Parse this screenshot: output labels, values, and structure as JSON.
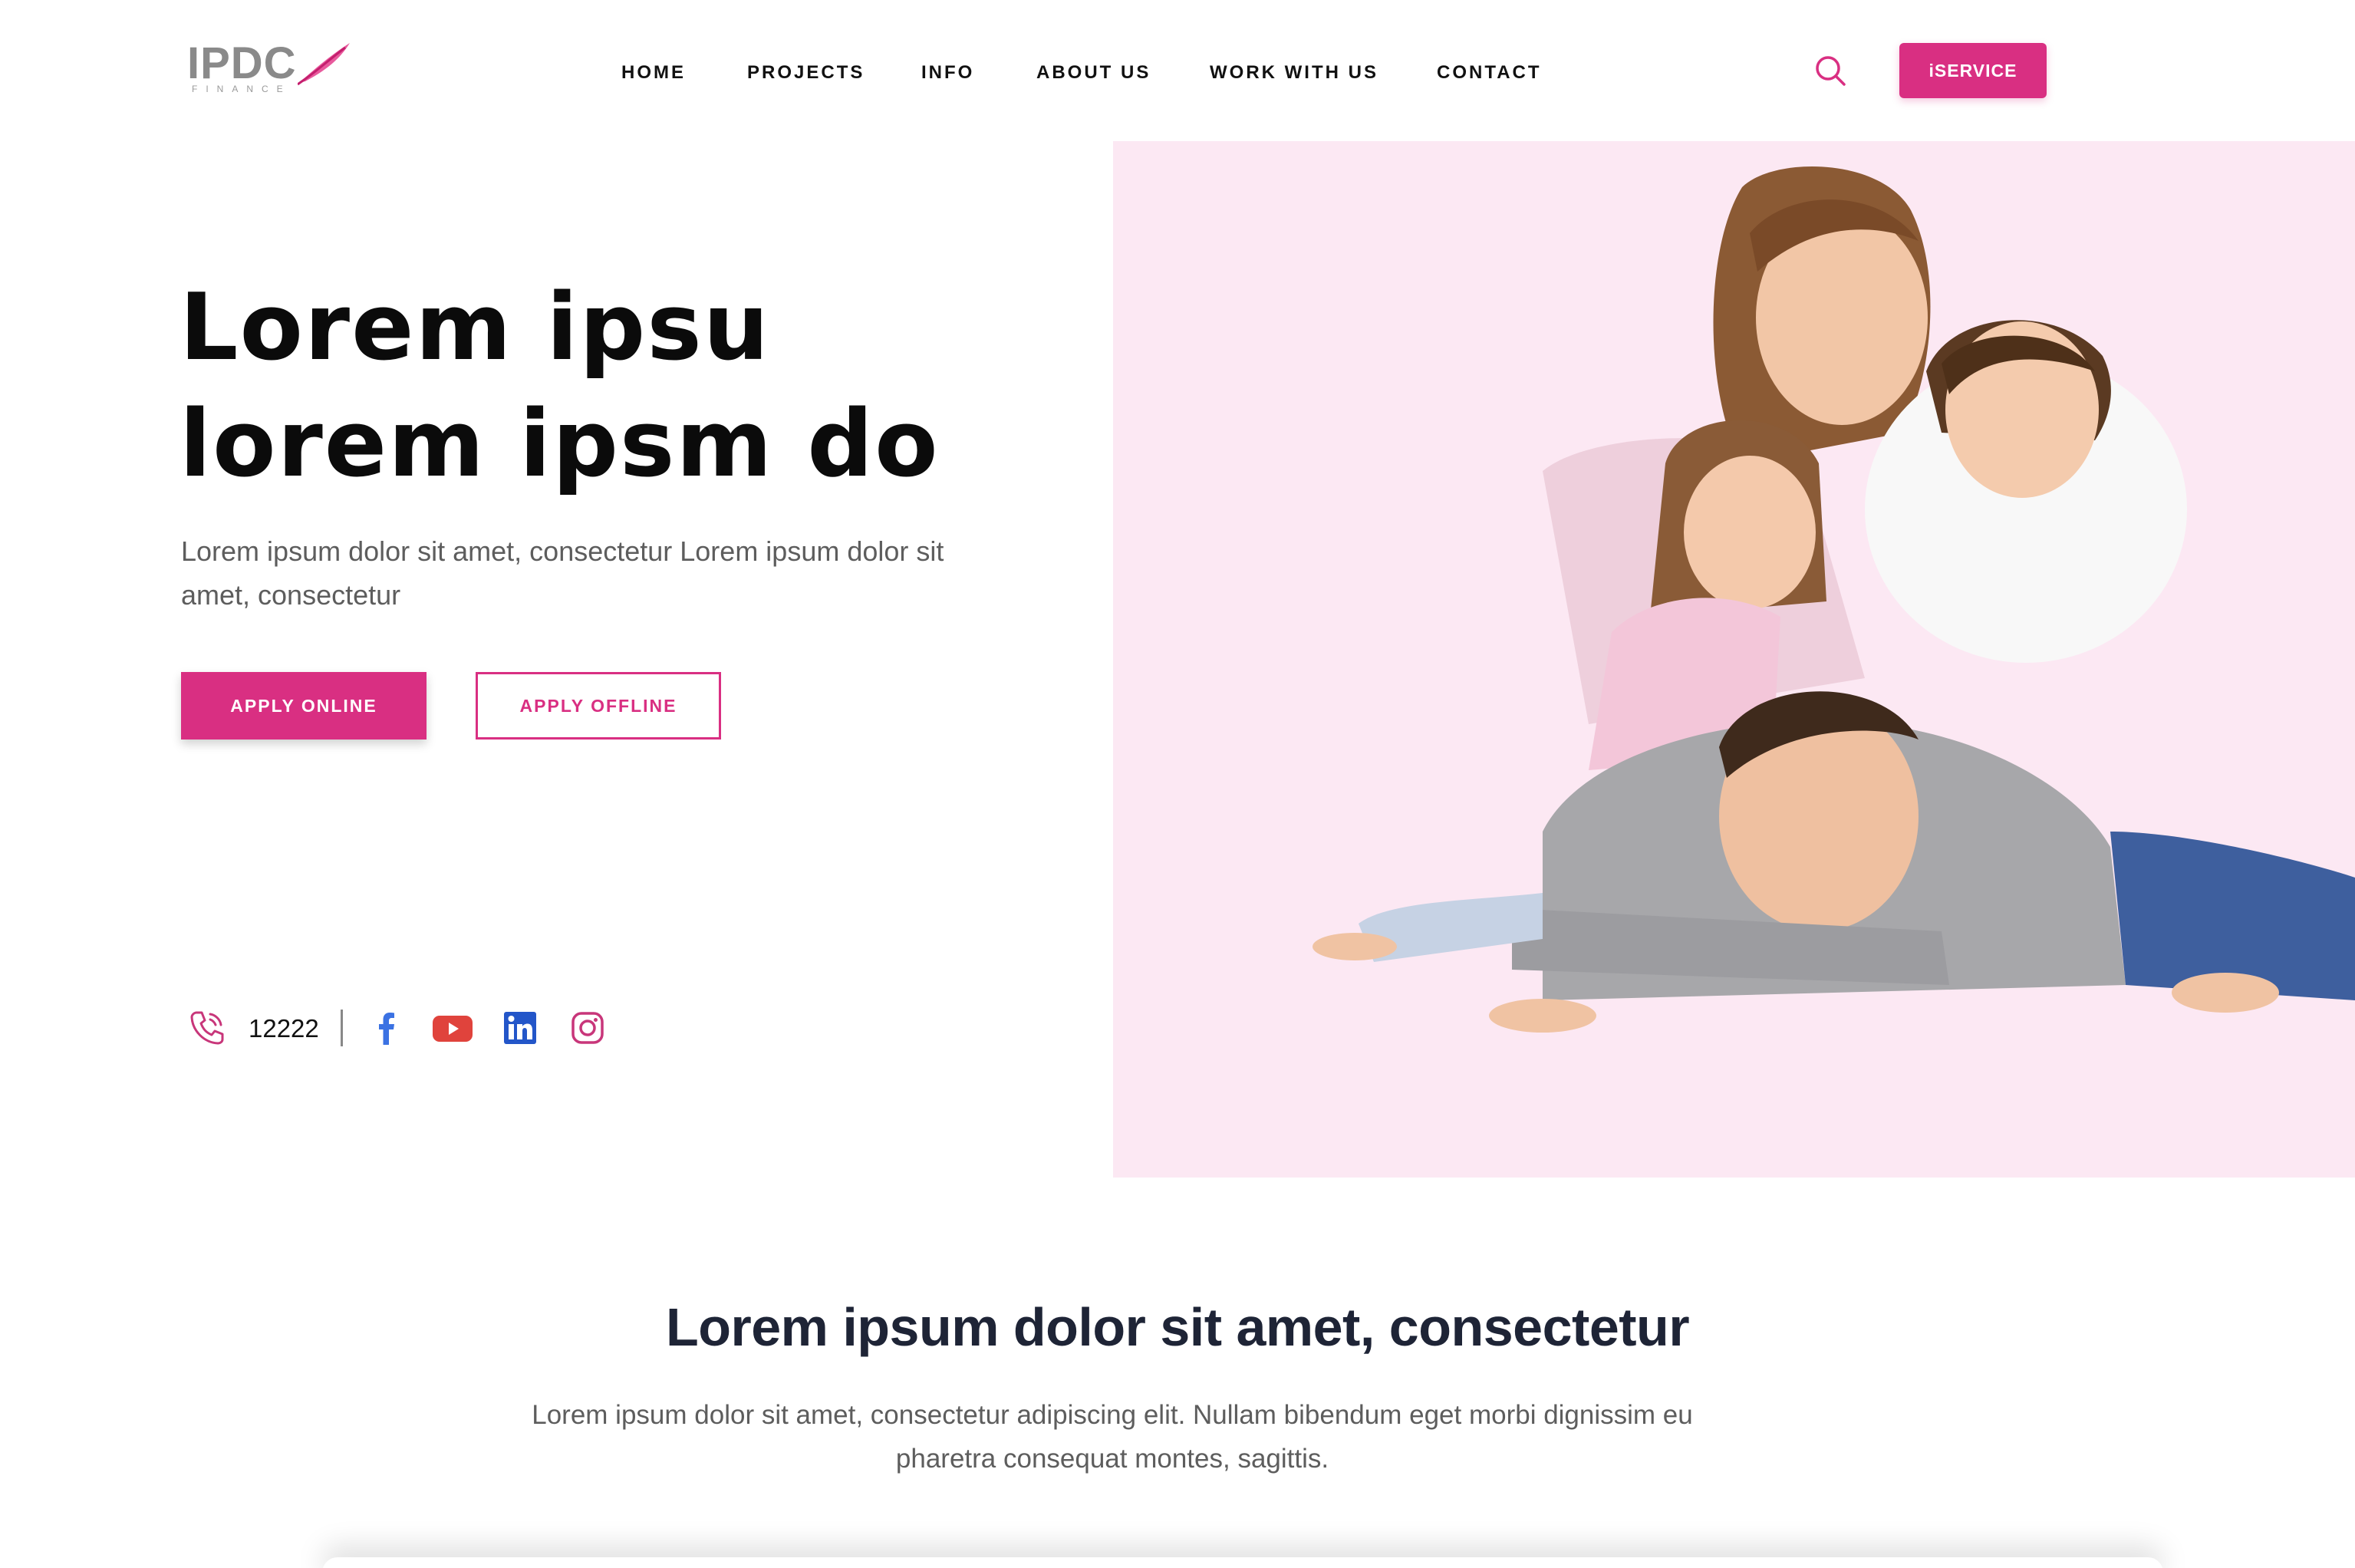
{
  "brand": {
    "logo_text": "IPDC",
    "logo_sub": "FINANCE"
  },
  "nav": {
    "items": [
      "HOME",
      "PROJECTS",
      "INFO",
      "ABOUT US",
      "WORK WITH US",
      "CONTACT"
    ],
    "cta_label": "iSERVICE"
  },
  "hero": {
    "title_line1": "Lorem ipsu",
    "title_line2": "lorem ipsm do",
    "description": "Lorem ipsum dolor sit amet, consectetur Lorem ipsum dolor sit amet, consectetur",
    "apply_online_label": "APPLY ONLINE",
    "apply_offline_label": "APPLY OFFLINE",
    "phone_number": "12222",
    "social_icons": [
      "facebook-icon",
      "youtube-icon",
      "linkedin-icon",
      "instagram-icon"
    ],
    "image_background": "#fce8f3"
  },
  "section": {
    "title": "Lorem ipsum dolor sit amet, consectetur",
    "description": "Lorem ipsum dolor sit amet, consectetur adipiscing elit. Nullam bibendum eget morbi dignissim eu pharetra consequat montes, sagittis."
  },
  "colors": {
    "accent": "#d92f82",
    "heading": "#0b0b0b",
    "section_heading": "#1e2436",
    "body_text": "#5d5d5d",
    "facebook": "#3b72e3",
    "youtube": "#e0433c",
    "linkedin": "#2356c9",
    "instagram": "#c8367a"
  }
}
